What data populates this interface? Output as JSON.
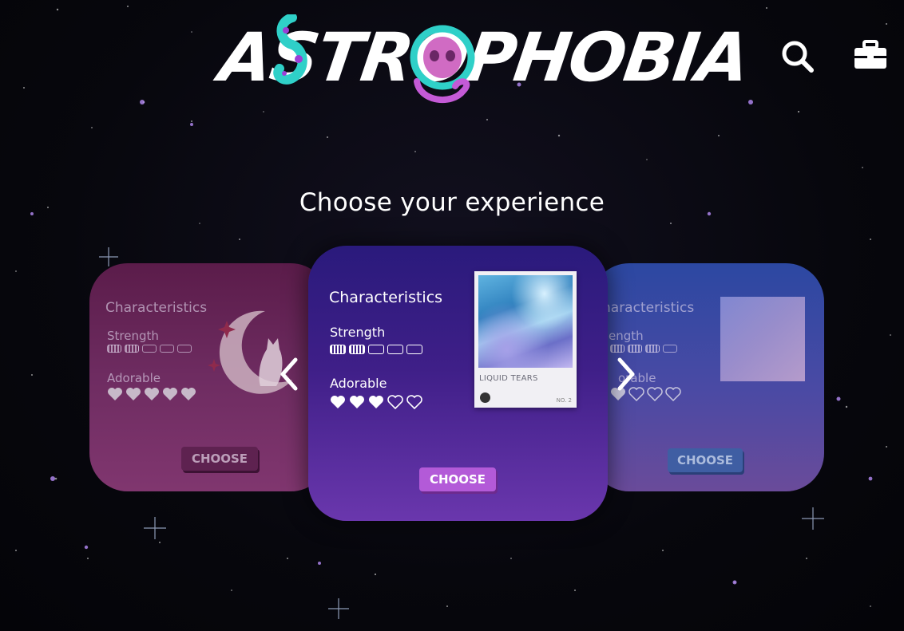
{
  "brand": {
    "logo_text": "ASTROPHOBIA"
  },
  "header": {
    "search_icon": "search-icon",
    "cart_icon": "briefcase-icon"
  },
  "page": {
    "title": "Choose your experience"
  },
  "cards": [
    {
      "id": "left",
      "characteristics_label": "Characteristics",
      "strength_label": "Strength",
      "strength_level": 2,
      "strength_max": 5,
      "adorable_label": "Adorable",
      "adorable_level": 5,
      "adorable_max": 5,
      "choose_label": "CHOOSE",
      "image_icon": "moon-cat-icon"
    },
    {
      "id": "center",
      "characteristics_label": "Characteristics",
      "strength_label": "Strength",
      "strength_level": 2,
      "strength_max": 5,
      "adorable_label": "Adorable",
      "adorable_level": 3,
      "adorable_max": 5,
      "choose_label": "CHOOSE",
      "album": {
        "title": "LIQUID TEARS",
        "number": "NO. 2"
      }
    },
    {
      "id": "right",
      "characteristics_label": "haracteristics",
      "strength_label": "ength",
      "strength_level": 3,
      "strength_max": 5,
      "adorable_label": "orable",
      "adorable_level": 1,
      "adorable_max": 4,
      "choose_label": "CHOOSE"
    }
  ],
  "carousel": {
    "prev_icon": "chevron-left-icon",
    "next_icon": "chevron-right-icon"
  },
  "colors": {
    "choose_center": "#b35ad8",
    "choose_left": "#5e2250",
    "choose_right": "#3f5ea3"
  }
}
